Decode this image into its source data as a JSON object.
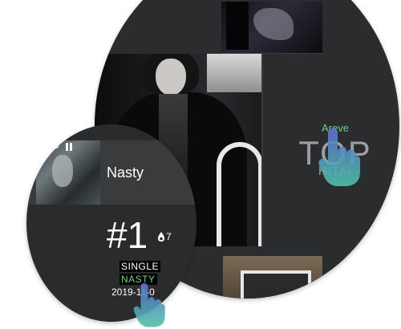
{
  "overview": {
    "artist": "Areve",
    "rank_label": "TOP",
    "country": "HITAI"
  },
  "single": {
    "title": "Nasty",
    "rank": "#1",
    "fire_count": "7",
    "type": "SINGLE",
    "name_upper": "NASTY",
    "release_date": "2019-11-0"
  },
  "colors": {
    "panel_dark": "#2b2c2e",
    "accent_green": "#71d184",
    "cursor_gradient_top": "#5a6fd6",
    "cursor_gradient_bottom": "#4ec2a3"
  },
  "icons": [
    "play-icon",
    "pause-icon",
    "fire-icon",
    "hand-pointer-icon"
  ]
}
